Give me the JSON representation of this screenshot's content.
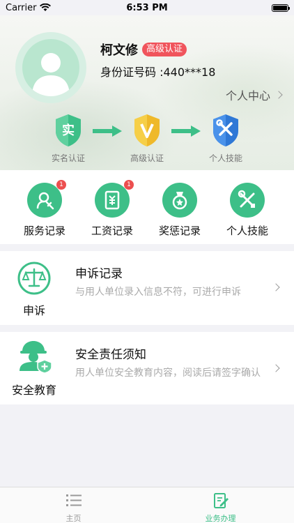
{
  "status_bar": {
    "carrier": "Carrier",
    "time": "6:53 PM"
  },
  "profile": {
    "name": "柯文修",
    "level_badge": "高级认证",
    "id_label": "身份证号码 :440***18",
    "center_link": "个人中心"
  },
  "steps": [
    {
      "label": "实名认证",
      "glyph": "实",
      "color": "#3dbf88"
    },
    {
      "label": "高级认证",
      "glyph": "V",
      "color": "#f2c233"
    },
    {
      "label": "个人技能",
      "glyph": "tools",
      "color": "#3a86e0"
    }
  ],
  "quick_menu": [
    {
      "label": "服务记录",
      "badge": "1",
      "icon": "service-record-icon"
    },
    {
      "label": "工资记录",
      "badge": "1",
      "icon": "salary-record-icon"
    },
    {
      "label": "奖惩记录",
      "badge": "",
      "icon": "reward-medal-icon"
    },
    {
      "label": "个人技能",
      "badge": "",
      "icon": "skills-tools-icon"
    }
  ],
  "appeal": {
    "caption": "申诉",
    "title": "申诉记录",
    "desc": "与用人单位录入信息不符，可进行申诉",
    "icon": "scales-icon"
  },
  "safety": {
    "caption": "安全教育",
    "title": "安全责任须知",
    "desc": "用人单位安全教育内容，阅读后请签字确认",
    "icon": "worker-helmet-icon"
  },
  "tabbar": [
    {
      "label": "主页",
      "active": false,
      "icon": "list-icon"
    },
    {
      "label": "业务办理",
      "active": true,
      "icon": "edit-document-icon"
    }
  ],
  "colors": {
    "accent": "#3dbf88",
    "badge": "#ec4f4f",
    "level": "#f0545c"
  }
}
